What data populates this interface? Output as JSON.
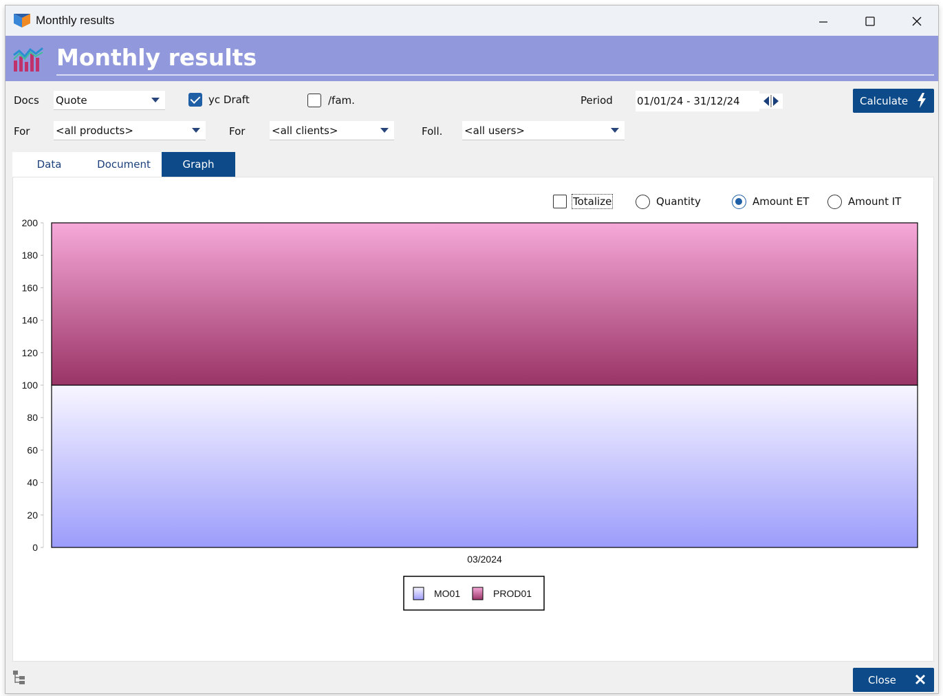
{
  "window": {
    "title": "Monthly results"
  },
  "banner": {
    "title": "Monthly results"
  },
  "filters": {
    "docs_label": "Docs",
    "docs_value": "Quote",
    "draft_label": "yc Draft",
    "draft_checked": true,
    "fam_label": "/fam.",
    "fam_checked": false,
    "period_label": "Period",
    "period_value": "01/01/24 - 31/12/24",
    "calculate_label": "Calculate",
    "for_products_label": "For",
    "products_value": "<all products>",
    "for_clients_label": "For",
    "clients_value": "<all clients>",
    "foll_label": "Foll.",
    "users_value": "<all users>"
  },
  "tabs": [
    {
      "label": "Data",
      "active": false
    },
    {
      "label": "Document",
      "active": false
    },
    {
      "label": "Graph",
      "active": true
    }
  ],
  "graph_options": {
    "totalize_label": "Totalize",
    "totalize_checked": false,
    "quantity_label": "Quantity",
    "amount_et_label": "Amount ET",
    "amount_it_label": "Amount IT",
    "selected": "Amount ET"
  },
  "chart_data": {
    "type": "bar",
    "stacked": true,
    "categories": [
      "03/2024"
    ],
    "series": [
      {
        "name": "MO01",
        "values": [
          100
        ],
        "color_top": "#f8f6ff",
        "color_bottom": "#9c9cfb"
      },
      {
        "name": "PROD01",
        "values": [
          100
        ],
        "color_top": "#f6a9d9",
        "color_bottom": "#9a3466"
      }
    ],
    "yticks": [
      0,
      20,
      40,
      60,
      80,
      100,
      120,
      140,
      160,
      180,
      200
    ],
    "ylim": [
      0,
      200
    ],
    "legend_position": "bottom-center",
    "grid": false
  },
  "footer": {
    "close_label": "Close"
  },
  "colors": {
    "banner": "#9199dc",
    "accent": "#0c4a8a",
    "check": "#1f5fa6"
  }
}
